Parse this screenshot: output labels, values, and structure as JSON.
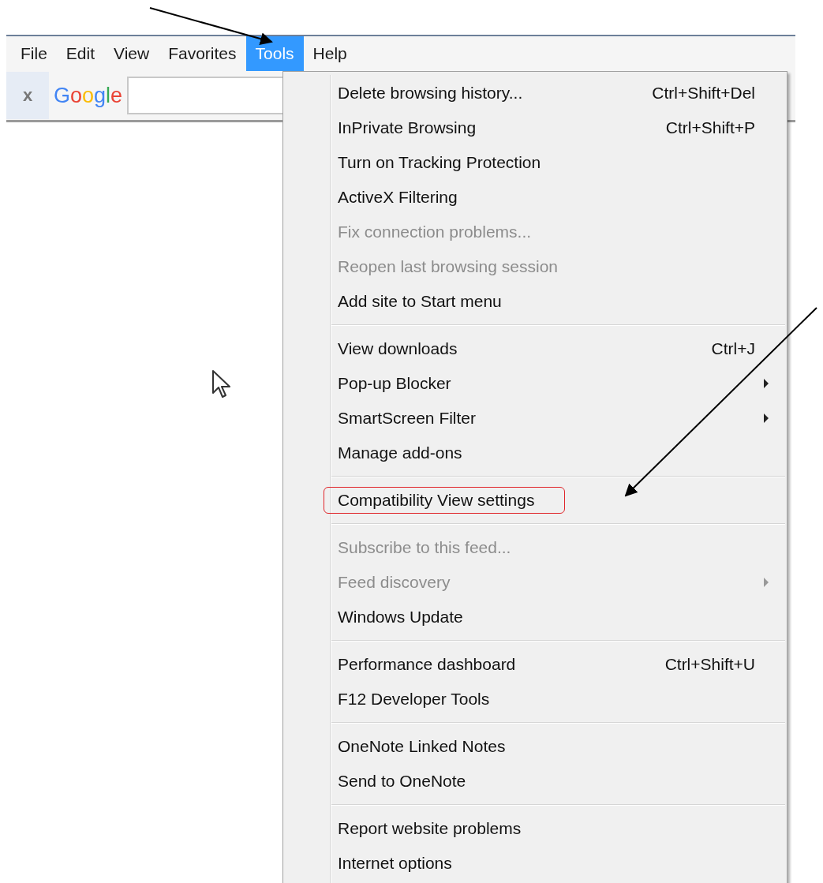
{
  "menubar": [
    {
      "label": "File",
      "selected": false
    },
    {
      "label": "Edit",
      "selected": false
    },
    {
      "label": "View",
      "selected": false
    },
    {
      "label": "Favorites",
      "selected": false
    },
    {
      "label": "Tools",
      "selected": true
    },
    {
      "label": "Help",
      "selected": false
    }
  ],
  "toolbar": {
    "close": "x",
    "logo": "Google"
  },
  "menu": {
    "groups": [
      {
        "items": [
          {
            "label": "Delete browsing history...",
            "shortcut": "Ctrl+Shift+Del",
            "disabled": false,
            "submenu": false,
            "outlined": false
          },
          {
            "label": "InPrivate Browsing",
            "shortcut": "Ctrl+Shift+P",
            "disabled": false,
            "submenu": false,
            "outlined": false
          },
          {
            "label": "Turn on Tracking Protection",
            "disabled": false,
            "submenu": false,
            "outlined": false
          },
          {
            "label": "ActiveX Filtering",
            "disabled": false,
            "submenu": false,
            "outlined": false
          },
          {
            "label": "Fix connection problems...",
            "disabled": true,
            "submenu": false,
            "outlined": false
          },
          {
            "label": "Reopen last browsing session",
            "disabled": true,
            "submenu": false,
            "outlined": false
          },
          {
            "label": "Add site to Start menu",
            "disabled": false,
            "submenu": false,
            "outlined": false
          }
        ]
      },
      {
        "items": [
          {
            "label": "View downloads",
            "shortcut": "Ctrl+J",
            "disabled": false,
            "submenu": false,
            "outlined": false
          },
          {
            "label": "Pop-up Blocker",
            "disabled": false,
            "submenu": true,
            "outlined": false
          },
          {
            "label": "SmartScreen Filter",
            "disabled": false,
            "submenu": true,
            "outlined": false
          },
          {
            "label": "Manage add-ons",
            "disabled": false,
            "submenu": false,
            "outlined": false
          }
        ]
      },
      {
        "items": [
          {
            "label": "Compatibility View settings",
            "disabled": false,
            "submenu": false,
            "outlined": true
          }
        ]
      },
      {
        "items": [
          {
            "label": "Subscribe to this feed...",
            "disabled": true,
            "submenu": false,
            "outlined": false
          },
          {
            "label": "Feed discovery",
            "disabled": true,
            "submenu": true,
            "outlined": false
          },
          {
            "label": "Windows Update",
            "disabled": false,
            "submenu": false,
            "outlined": false
          }
        ]
      },
      {
        "items": [
          {
            "label": "Performance dashboard",
            "shortcut": "Ctrl+Shift+U",
            "disabled": false,
            "submenu": false,
            "outlined": false
          },
          {
            "label": "F12 Developer Tools",
            "disabled": false,
            "submenu": false,
            "outlined": false
          }
        ]
      },
      {
        "items": [
          {
            "label": "OneNote Linked Notes",
            "disabled": false,
            "submenu": false,
            "outlined": false
          },
          {
            "label": "Send to OneNote",
            "disabled": false,
            "submenu": false,
            "outlined": false
          }
        ]
      },
      {
        "items": [
          {
            "label": "Report website problems",
            "disabled": false,
            "submenu": false,
            "outlined": false
          },
          {
            "label": "Internet options",
            "disabled": false,
            "submenu": false,
            "outlined": false
          }
        ]
      }
    ]
  }
}
